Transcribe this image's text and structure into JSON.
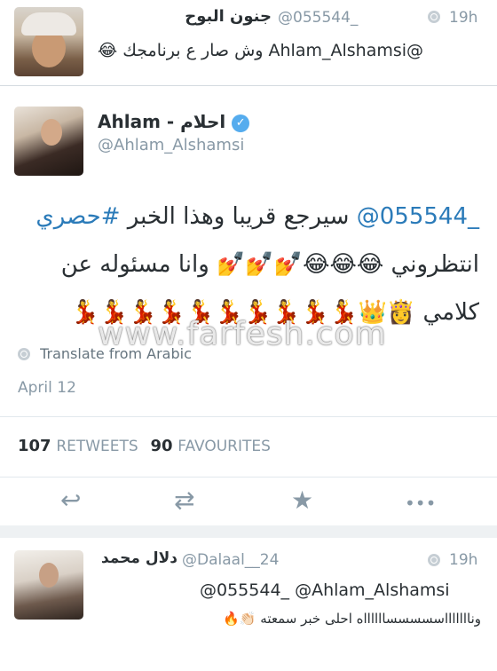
{
  "top_tweet": {
    "display_name": "جنون البوح",
    "handle": "@055544_",
    "time": "19h",
    "text": "@Ahlam_Alshamsi وش صار ع برنامجك 😂"
  },
  "main_tweet": {
    "display_name": "Ahlam - احلام",
    "handle": "@Ahlam_Alshamsi",
    "line1_mention": "@055544_",
    "line1_text": " سيرجع قريبا وهذا الخبر ",
    "line1_hashtag": "#حصري",
    "line2": "انتظروني 😂😂😂💅💅💅 وانا مسئوله عن",
    "line3": "كلامي 👸👑💃💃💃💃💃💃💃💃💃💃",
    "translate_label": "Translate from Arabic",
    "date": "April 12",
    "retweets_count": "107",
    "retweets_label": "RETWEETS",
    "favourites_count": "90",
    "favourites_label": "FAVOURITES"
  },
  "actions": {
    "reply_icon": "↩",
    "retweet_icon": "⇄",
    "favorite_icon": "★",
    "more_icon": "•••"
  },
  "watermark": "www.farfesh.com",
  "reply_tweet": {
    "display_name": "دلال محمد",
    "handle": "@Dalaal__24",
    "time": "19h",
    "line1": "@055544_ @Ahlam_Alshamsi",
    "line2": "وناااااااسسسسسااااااه احلى خبر سمعته 👏🏻🔥"
  }
}
